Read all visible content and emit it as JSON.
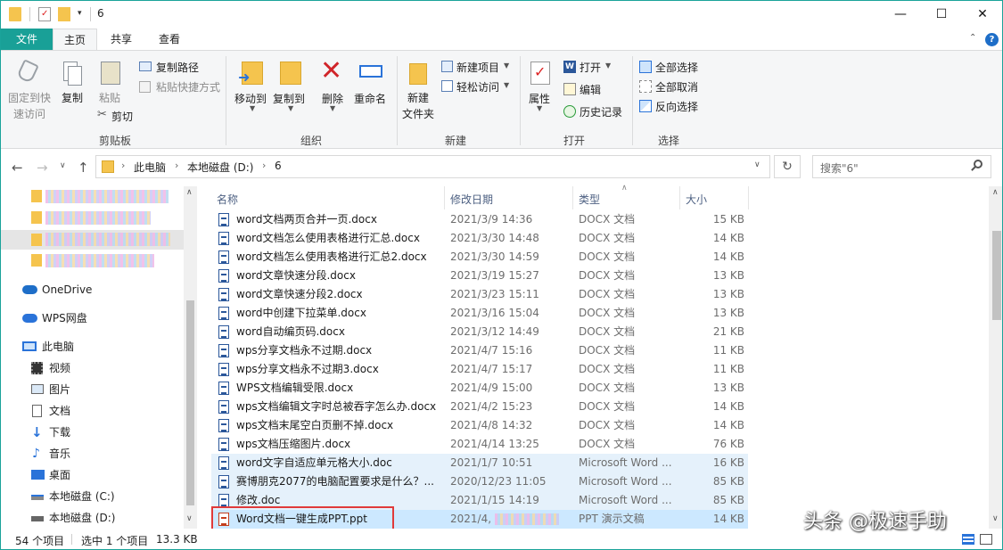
{
  "window": {
    "title": "6",
    "controls": {
      "minimize": "—",
      "maximize": "☐",
      "close": "✕"
    }
  },
  "tabs": [
    "文件",
    "主页",
    "共享",
    "查看"
  ],
  "ribbon": {
    "clipboard": {
      "pin": "固定到快\n速访问",
      "copy": "复制",
      "paste": "粘贴",
      "copy_path": "复制路径",
      "paste_shortcut": "粘贴快捷方式",
      "cut": "剪切",
      "group": "剪贴板"
    },
    "organize": {
      "move_to": "移动到",
      "copy_to": "复制到",
      "delete": "删除",
      "rename": "重命名",
      "group": "组织"
    },
    "new": {
      "new_folder": "新建\n文件夹",
      "new_item": "新建项目",
      "easy_access": "轻松访问",
      "group": "新建"
    },
    "open": {
      "properties": "属性",
      "open": "打开",
      "edit": "编辑",
      "history": "历史记录",
      "group": "打开"
    },
    "select": {
      "select_all": "全部选择",
      "select_none": "全部取消",
      "invert": "反向选择",
      "group": "选择"
    }
  },
  "address": {
    "crumbs": [
      "此电脑",
      "本地磁盘 (D:)",
      "6"
    ],
    "search_placeholder": "搜索\"6\""
  },
  "nav": {
    "items": [
      "OneDrive",
      "WPS网盘",
      "此电脑",
      "视频",
      "图片",
      "文档",
      "下载",
      "音乐",
      "桌面",
      "本地磁盘 (C:)",
      "本地磁盘 (D:)"
    ]
  },
  "list": {
    "headers": {
      "name": "名称",
      "date": "修改日期",
      "type": "类型",
      "size": "大小"
    },
    "rows": [
      {
        "name": "word文档两页合并一页.docx",
        "date": "2021/3/9 14:36",
        "type": "DOCX 文档",
        "size": "15 KB"
      },
      {
        "name": "word文档怎么使用表格进行汇总.docx",
        "date": "2021/3/30 14:48",
        "type": "DOCX 文档",
        "size": "14 KB"
      },
      {
        "name": "word文档怎么使用表格进行汇总2.docx",
        "date": "2021/3/30 14:59",
        "type": "DOCX 文档",
        "size": "14 KB"
      },
      {
        "name": "word文章快速分段.docx",
        "date": "2021/3/19 15:27",
        "type": "DOCX 文档",
        "size": "13 KB"
      },
      {
        "name": "word文章快速分段2.docx",
        "date": "2021/3/23 15:11",
        "type": "DOCX 文档",
        "size": "13 KB"
      },
      {
        "name": "word中创建下拉菜单.docx",
        "date": "2021/3/16 15:04",
        "type": "DOCX 文档",
        "size": "13 KB"
      },
      {
        "name": "word自动编页码.docx",
        "date": "2021/3/12 14:49",
        "type": "DOCX 文档",
        "size": "21 KB"
      },
      {
        "name": "wps分享文档永不过期.docx",
        "date": "2021/4/7 15:16",
        "type": "DOCX 文档",
        "size": "11 KB"
      },
      {
        "name": "wps分享文档永不过期3.docx",
        "date": "2021/4/7 15:17",
        "type": "DOCX 文档",
        "size": "11 KB"
      },
      {
        "name": "WPS文档编辑受限.docx",
        "date": "2021/4/9 15:00",
        "type": "DOCX 文档",
        "size": "13 KB"
      },
      {
        "name": "wps文档编辑文字时总被吞字怎么办.docx",
        "date": "2021/4/2 15:23",
        "type": "DOCX 文档",
        "size": "14 KB"
      },
      {
        "name": "wps文档末尾空白页删不掉.docx",
        "date": "2021/4/8 14:32",
        "type": "DOCX 文档",
        "size": "14 KB"
      },
      {
        "name": "wps文档压缩图片.docx",
        "date": "2021/4/14 13:25",
        "type": "DOCX 文档",
        "size": "76 KB"
      },
      {
        "name": "word文字自适应单元格大小.doc",
        "date": "2021/1/7 10:51",
        "type": "Microsoft Word ...",
        "size": "16 KB"
      },
      {
        "name": "赛博朋克2077的电脑配置要求是什么？...",
        "date": "2020/12/23 11:05",
        "type": "Microsoft Word ...",
        "size": "85 KB"
      },
      {
        "name": "修改.doc",
        "date": "2021/1/15 14:19",
        "type": "Microsoft Word ...",
        "size": "85 KB"
      },
      {
        "name": "Word文档一键生成PPT.ppt",
        "date": "2021/4,",
        "type": "PPT 演示文稿",
        "size": "14 KB"
      }
    ]
  },
  "status": {
    "count": "54 个项目",
    "selection": "选中 1 个项目",
    "size": "13.3 KB"
  },
  "watermark": "头条 @极速手助"
}
